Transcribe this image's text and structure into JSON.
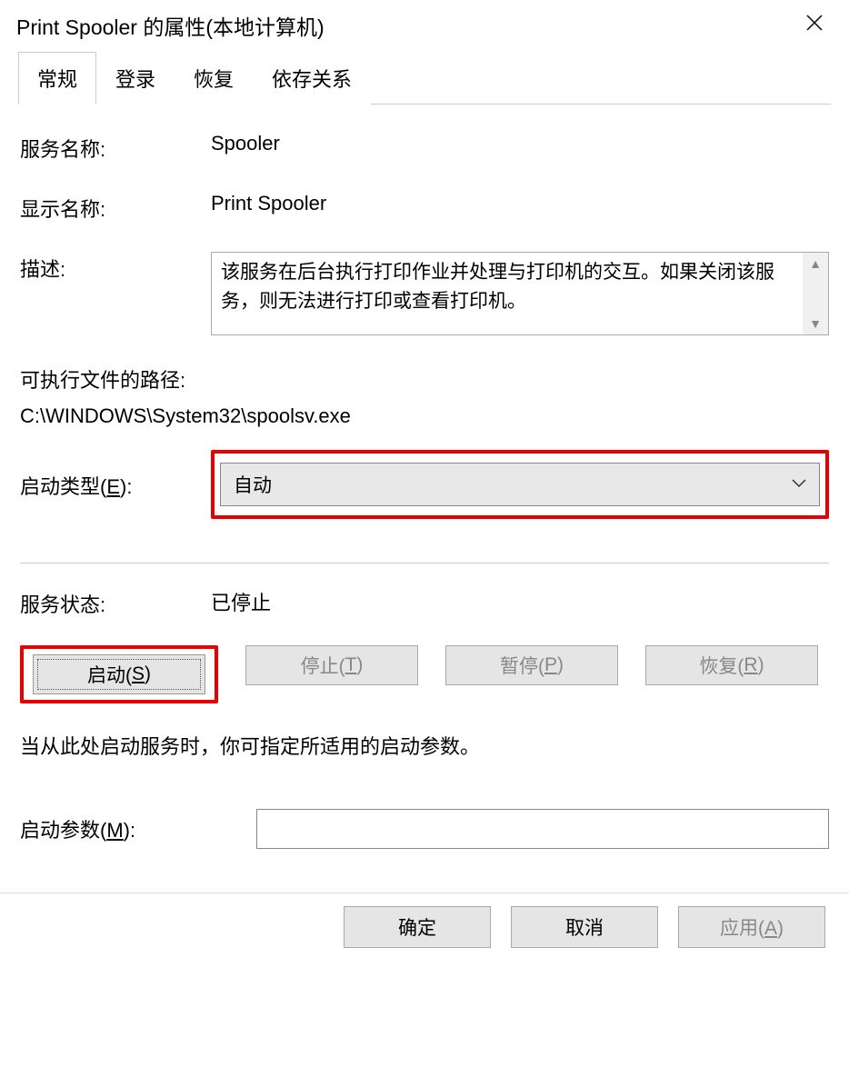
{
  "titlebar": {
    "title": "Print Spooler 的属性(本地计算机)"
  },
  "tabs": {
    "general": "常规",
    "logon": "登录",
    "recovery": "恢复",
    "dependencies": "依存关系"
  },
  "fields": {
    "service_name_label": "服务名称:",
    "service_name_value": "Spooler",
    "display_name_label": "显示名称:",
    "display_name_value": "Print Spooler",
    "description_label": "描述:",
    "description_value": "该服务在后台执行打印作业并处理与打印机的交互。如果关闭该服务，则无法进行打印或查看打印机。",
    "exe_path_label": "可执行文件的路径:",
    "exe_path_value": "C:\\WINDOWS\\System32\\spoolsv.exe",
    "startup_type_label": "启动类型(E):",
    "startup_type_value": "自动",
    "service_status_label": "服务状态:",
    "service_status_value": "已停止",
    "hint": "当从此处启动服务时，你可指定所适用的启动参数。",
    "start_params_label": "启动参数(M):",
    "start_params_value": ""
  },
  "buttons": {
    "start": "启动(S)",
    "stop": "停止(T)",
    "pause": "暂停(P)",
    "resume": "恢复(R)",
    "ok": "确定",
    "cancel": "取消",
    "apply": "应用(A)"
  }
}
